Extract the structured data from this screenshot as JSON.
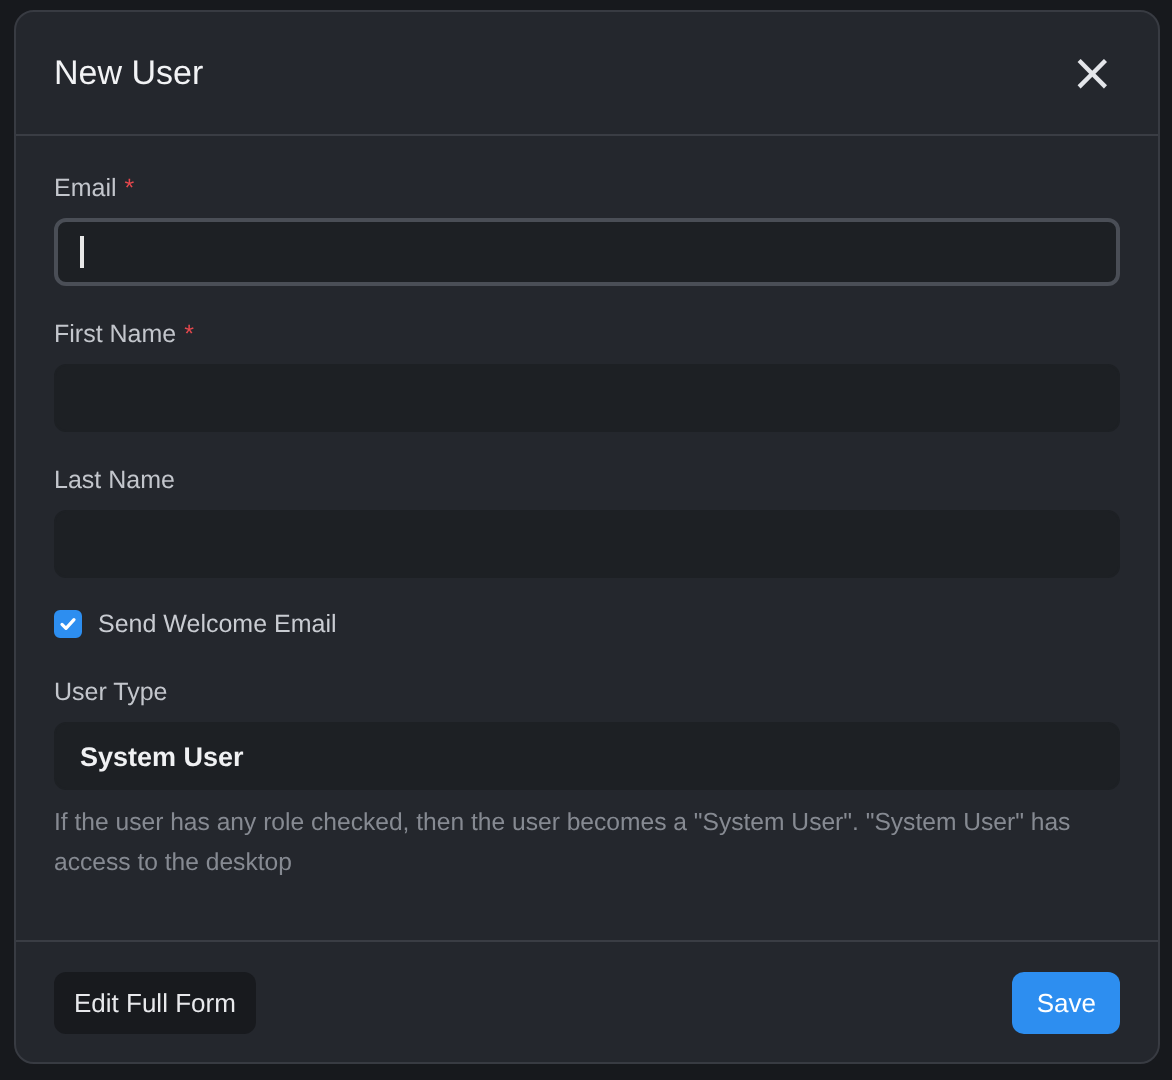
{
  "dialog": {
    "title": "New User",
    "close": "×",
    "fields": [
      {
        "kind": "input",
        "label": "Email",
        "required_mark": "*",
        "focused": true
      },
      {
        "kind": "input",
        "label": "First Name",
        "required_mark": "*",
        "focused": false
      },
      {
        "kind": "input",
        "label": "Last Name",
        "focused": false
      },
      {
        "kind": "checkbox",
        "label": "Send Welcome Email",
        "checked": true
      },
      {
        "kind": "select",
        "label": "User Type",
        "value": "System User",
        "description": "If the user has any role checked, then the user becomes a \"System User\". \"System User\" has access to the desktop"
      }
    ],
    "buttons": [
      {
        "label": "Edit Full Form",
        "kind": "secondary"
      },
      {
        "label": "Save",
        "kind": "primary"
      }
    ]
  }
}
